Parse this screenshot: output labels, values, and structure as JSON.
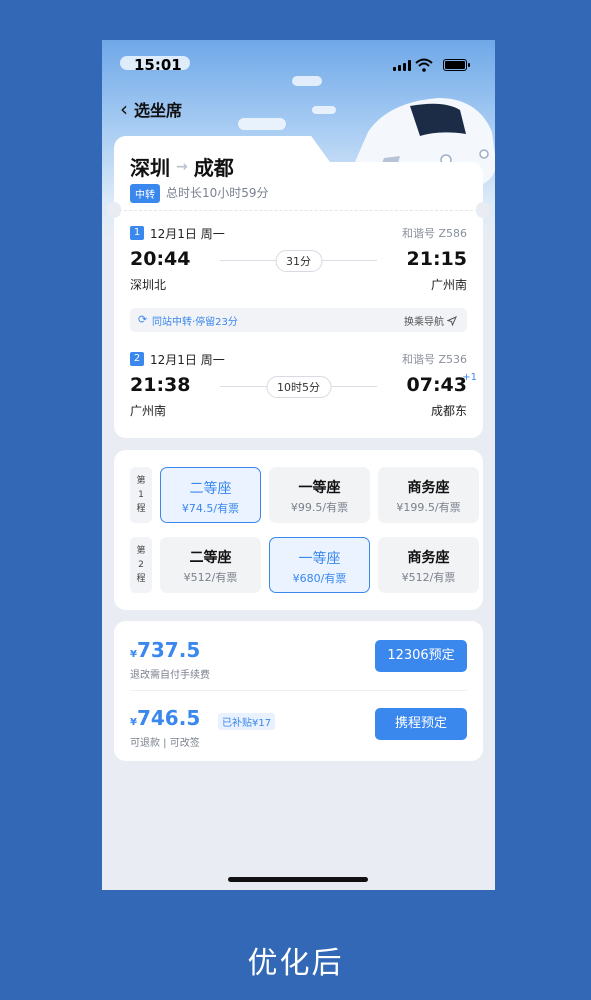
{
  "status_bar": {
    "time": "15:01"
  },
  "nav": {
    "title": "选坐席"
  },
  "route": {
    "from": "深圳",
    "to": "成都",
    "transfer_tag": "中转",
    "total_duration": "总时长10小时59分"
  },
  "legs": [
    {
      "num": "1",
      "date": "12月1日  周一",
      "train": "和谐号 Z586",
      "dep_time": "20:44",
      "arr_time": "21:15",
      "duration": "31分",
      "dep_station": "深圳北",
      "arr_station": "广州南",
      "plus_day": ""
    },
    {
      "num": "2",
      "date": "12月1日  周一",
      "train": "和谐号 Z536",
      "dep_time": "21:38",
      "arr_time": "07:43",
      "duration": "10时5分",
      "dep_station": "广州南",
      "arr_station": "成都东",
      "plus_day": "+1"
    }
  ],
  "transfer_info": {
    "text": "同站中转·停留23分",
    "nav_label": "换乘导航"
  },
  "seat_segments": [
    {
      "label": "第\n1\n程",
      "seats": [
        {
          "name": "二等座",
          "price": "¥74.5",
          "avail": "有票",
          "selected": true
        },
        {
          "name": "一等座",
          "price": "¥99.5",
          "avail": "有票",
          "selected": false
        },
        {
          "name": "商务座",
          "price": "¥199.5",
          "avail": "有票",
          "selected": false
        }
      ]
    },
    {
      "label": "第\n2\n程",
      "seats": [
        {
          "name": "二等座",
          "price": "¥512",
          "avail": "有票",
          "selected": false
        },
        {
          "name": "一等座",
          "price": "¥680",
          "avail": "有票",
          "selected": true
        },
        {
          "name": "商务座",
          "price": "¥512",
          "avail": "有票",
          "selected": false
        }
      ]
    }
  ],
  "prices": [
    {
      "currency": "¥",
      "amount": "737.5",
      "note": "退改需自付手续费",
      "subsidy": "",
      "button": "12306预定"
    },
    {
      "currency": "¥",
      "amount": "746.5",
      "note": "可退款 | 可改签",
      "subsidy": "已补贴¥17",
      "button": "携程预定"
    }
  ],
  "caption": "优化后",
  "colors": {
    "accent": "#3a87ee",
    "background": "#3268b6"
  },
  "icons": {
    "back": "chevron-left-icon",
    "transfer": "refresh-icon",
    "nav": "navigation-arrow-icon"
  }
}
